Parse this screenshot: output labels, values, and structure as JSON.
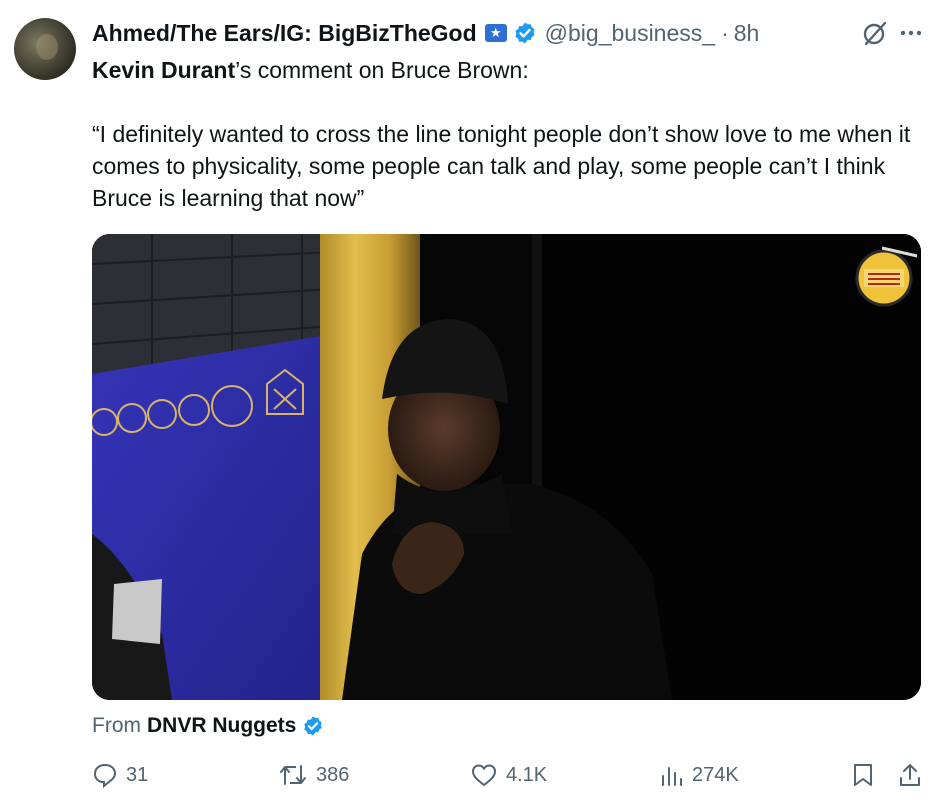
{
  "tweet": {
    "author": {
      "display_name": "Ahmed/The Ears/IG: BigBizTheGod",
      "handle": "@big_business_",
      "time": "8h",
      "separator": "·"
    },
    "subtitle": {
      "name": "Kevin Durant",
      "rest": "’s comment on Bruce Brown:"
    },
    "quote": "“I definitely wanted to cross the line tonight people don’t show love to me when it comes to physicality, some people can talk and play, some people can’t I think Bruce is learning that now”",
    "from": {
      "prefix": "From",
      "source": "DNVR Nuggets"
    },
    "stats": {
      "replies": "31",
      "reposts": "386",
      "likes": "4.1K",
      "views": "274K"
    }
  },
  "icons": [
    "grok-icon",
    "more-icon",
    "verified-icon",
    "reply-icon",
    "repost-icon",
    "like-icon",
    "views-icon",
    "bookmark-icon",
    "share-icon"
  ],
  "colors": {
    "verified_blue": "#1d9bf0",
    "secondary_text": "#536471",
    "primary_text": "#0f1419",
    "wall_blue": "#2f2fa8"
  }
}
